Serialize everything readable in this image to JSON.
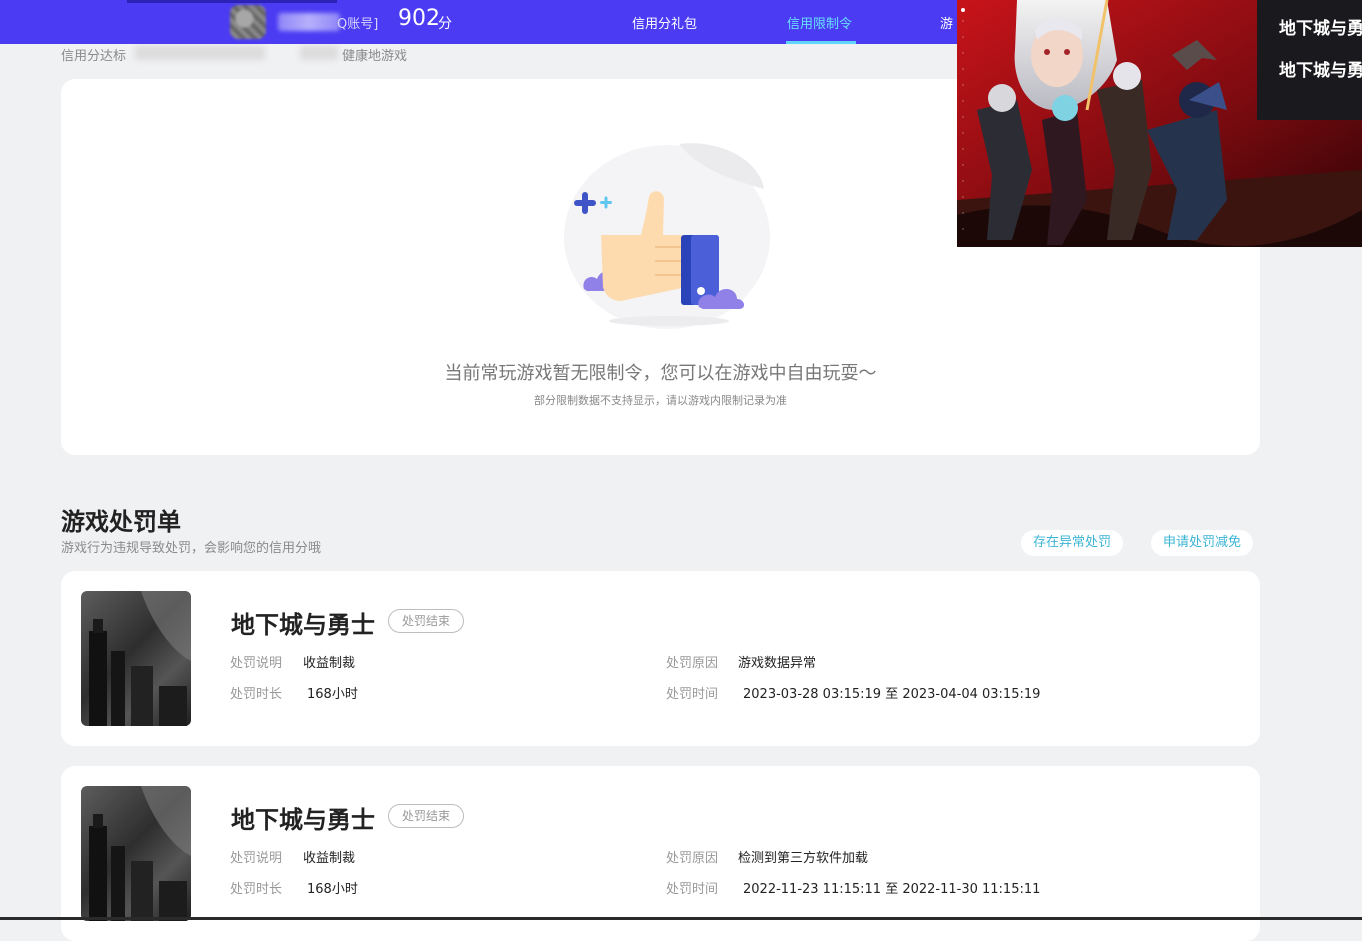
{
  "header": {
    "account_suffix": "Q账号]",
    "score": "902",
    "score_unit": "分",
    "nav": [
      "信用分礼包",
      "信用限制令",
      "游"
    ],
    "active_nav": "信用限制令"
  },
  "subtitle": {
    "start": "信用分达标",
    "end": "健康地游戏"
  },
  "restriction": {
    "empty_title": "当前常玩游戏暂无限制令，您可以在游戏中自由玩耍～",
    "empty_note": "部分限制数据不支持显示，请以游戏内限制记录为准"
  },
  "penalties": {
    "title": "游戏处罚单",
    "description": "游戏行为违规导致处罚，会影响您的信用分哦",
    "buttons": [
      "存在异常处罚",
      "申请处罚减免"
    ],
    "labels": {
      "explain": "处罚说明",
      "duration": "处罚时长",
      "reason": "处罚原因",
      "time": "处罚时间"
    },
    "items": [
      {
        "game": "地下城与勇士",
        "status": "处罚结束",
        "explain": "收益制裁",
        "duration": "168小时",
        "reason": "游戏数据异常",
        "time": "2023-03-28 03:15:19 至 2023-04-04 03:15:19"
      },
      {
        "game": "地下城与勇士",
        "status": "处罚结束",
        "explain": "收益制裁",
        "duration": "168小时",
        "reason": "检测到第三方软件加载",
        "time": "2022-11-23 11:15:11 至 2022-11-30 11:15:11"
      }
    ]
  },
  "overlay": {
    "logo_text": "地下城与勇士"
  },
  "colors": {
    "header_bg": "#4b3cf3",
    "active_nav": "#68e0ff",
    "button_text": "#3bb4d6",
    "page_bg": "#f0f1f3"
  }
}
